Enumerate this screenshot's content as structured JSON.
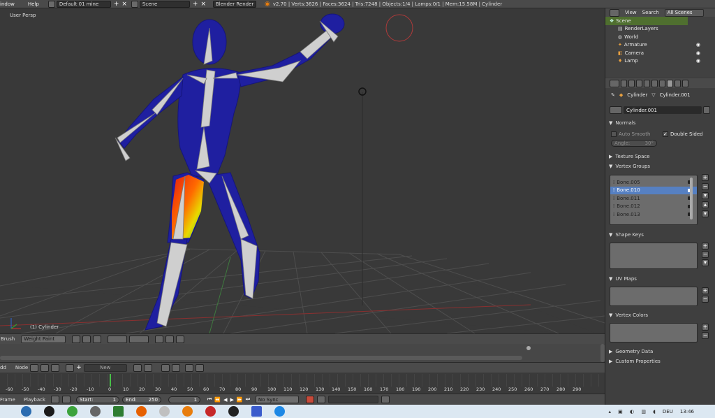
{
  "topbar": {
    "menus": [
      "indow",
      "Help"
    ],
    "layout": "Default 01 mine",
    "scene": "Scene",
    "engine": "Blender Render",
    "stats": "v2.70 | Verts:3626 | Faces:3624 | Tris:7248 | Objects:1/4 | Lamps:0/1 | Mem:15.58M | Cylinder"
  },
  "viewport": {
    "view_label": "User Persp",
    "object_label": "(1) Cylinder",
    "colors": {
      "bg": "#393939",
      "grid": "#4d4d4d",
      "mesh": "#1f1fa0",
      "bone": "#c8c8c8"
    }
  },
  "viewport_header": {
    "brush": "Brush",
    "mode": "Weight Paint"
  },
  "outliner": {
    "tabs": [
      "View",
      "Search"
    ],
    "filter": "All Scenes",
    "items": [
      {
        "label": "Scene",
        "icon": "scene-icon"
      },
      {
        "label": "RenderLayers",
        "icon": "renderlayers-icon"
      },
      {
        "label": "World",
        "icon": "world-icon"
      },
      {
        "label": "Armature",
        "icon": "armature-icon"
      },
      {
        "label": "Camera",
        "icon": "camera-icon"
      },
      {
        "label": "Lamp",
        "icon": "lamp-icon"
      }
    ]
  },
  "properties": {
    "breadcrumb": [
      "Cylinder",
      "Cylinder.001"
    ],
    "mesh_name": "Cylinder.001",
    "normals_title": "Normals",
    "auto_smooth": "Auto Smooth",
    "double_sided": "Double Sided",
    "angle_label": "Angle:",
    "angle_value": "30°",
    "texture_space": "Texture Space",
    "vertex_groups_title": "Vertex Groups",
    "vertex_groups": [
      "Bone.005",
      "Bone.010",
      "Bone.011",
      "Bone.012",
      "Bone.013"
    ],
    "selected_group": "Bone.010",
    "shape_keys": "Shape Keys",
    "uv_maps": "UV Maps",
    "vertex_colors": "Vertex Colors",
    "geometry_data": "Geometry Data",
    "custom_properties": "Custom Properties"
  },
  "node_header": {
    "prefix": "dd",
    "node_menu": "Node",
    "new_button": "New"
  },
  "timeline": {
    "ruler": [
      "-60",
      "-50",
      "-40",
      "-30",
      "-20",
      "-10",
      "0",
      "10",
      "20",
      "30",
      "40",
      "50",
      "60",
      "70",
      "80",
      "90",
      "100",
      "110",
      "120",
      "130",
      "140",
      "150",
      "160",
      "170",
      "180",
      "190",
      "200",
      "210",
      "220",
      "230",
      "240",
      "250",
      "260",
      "270",
      "280",
      "290"
    ],
    "frame_label": "Frame",
    "playback_label": "Playback",
    "start_label": "Start:",
    "start_value": "1",
    "end_label": "End:",
    "end_value": "250",
    "current_frame": "1",
    "sync": "No Sync"
  },
  "taskbar": {
    "time": "13:46",
    "locale": "DEU",
    "icon_colors": [
      "#2b6cb0",
      "#1b1b1b",
      "#3ca33c",
      "#666666",
      "#2e7d32",
      "#e66000",
      "#c0c0c0",
      "#e87d0d",
      "#c62828",
      "#222222",
      "#3b5ccc",
      "#1e88e5"
    ]
  }
}
